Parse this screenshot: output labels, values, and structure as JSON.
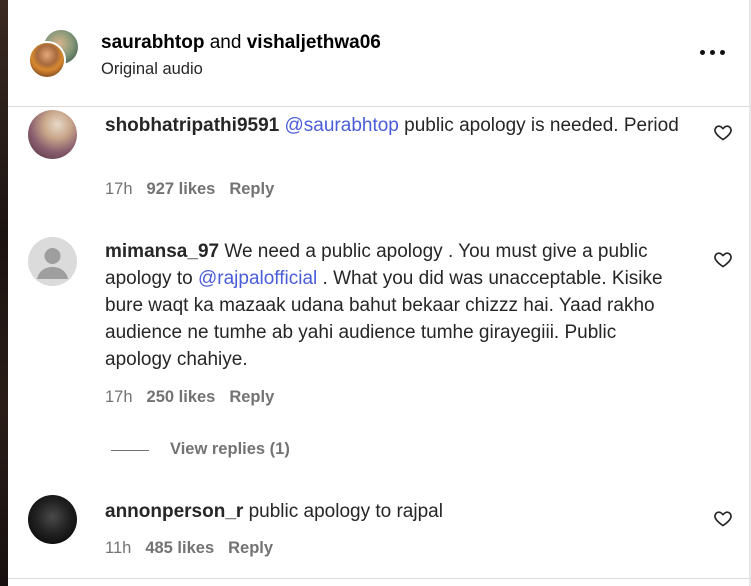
{
  "header": {
    "user1": "saurabhtop",
    "and_text": "and",
    "user2": "vishaljethwa06",
    "subtitle": "Original audio",
    "more_icon": "more-horizontal-icon"
  },
  "comments": [
    {
      "username": "shobhatripathi9591",
      "segments": [
        {
          "type": "mention",
          "text": "@saurabhtop"
        },
        {
          "type": "text",
          "text": " public apology is needed. Period"
        }
      ],
      "time": "17h",
      "likes": "927 likes",
      "reply": "Reply",
      "heart_icon": "heart-outline-icon"
    },
    {
      "username": "mimansa_97",
      "segments": [
        {
          "type": "text",
          "text": " We need a public apology . You must give a public apology to "
        },
        {
          "type": "mention",
          "text": "@rajpalofficial"
        },
        {
          "type": "text",
          "text": " . What you did was unacceptable. Kisike bure waqt ka mazaak udana bahut bekaar chizzz hai. Yaad rakho audience ne tumhe ab yahi audience tumhe girayegiii. Public apology chahiye."
        }
      ],
      "time": "17h",
      "likes": "250 likes",
      "reply": "Reply",
      "view_replies": "View replies (1)",
      "heart_icon": "heart-outline-icon"
    },
    {
      "username": "annonperson_r",
      "segments": [
        {
          "type": "text",
          "text": " public apology to rajpal"
        }
      ],
      "time": "11h",
      "likes": "485 likes",
      "reply": "Reply",
      "heart_icon": "heart-outline-icon"
    }
  ],
  "colors": {
    "mention": "#4a5dd8",
    "secondary_text": "#737373",
    "divider": "#dbdbdb"
  }
}
